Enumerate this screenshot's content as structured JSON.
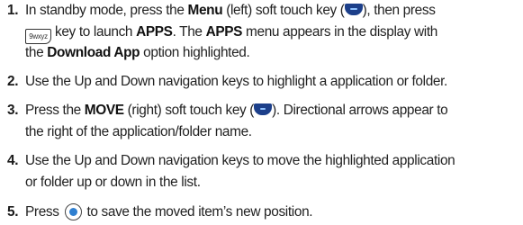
{
  "steps": [
    {
      "number": "1.",
      "lines": [
        {
          "a": "In standby mode, press the ",
          "b1": "Menu",
          "c": " (left) soft touch key (",
          "d": "), then press"
        },
        {
          "key9": "9wxyz",
          "a": "key to launch ",
          "b1": "APPS",
          "c": ". The ",
          "b2": "APPS",
          "d": " menu appears in the display with"
        },
        {
          "a": "the ",
          "b1": "Download App",
          "c": " option highlighted."
        }
      ]
    },
    {
      "number": "2.",
      "lines": [
        {
          "a": "Use the Up and Down navigation keys to highlight a application or folder."
        }
      ]
    },
    {
      "number": "3.",
      "lines": [
        {
          "a": "Press the ",
          "b1": "MOVE",
          "c": " (right) soft touch key (",
          "d": "). Directional arrows appear to"
        },
        {
          "a": "the right of the application/folder name."
        }
      ]
    },
    {
      "number": "4.",
      "lines": [
        {
          "a": "Use the Up and Down navigation keys to move the highlighted application"
        },
        {
          "a": "or folder up or down in the list."
        }
      ]
    },
    {
      "number": "5.",
      "lines": [
        {
          "a": "Press ",
          "c": " to save the moved item’s new position."
        }
      ]
    }
  ],
  "icons": {
    "left_soft_key": "left-soft-key-icon",
    "right_soft_key": "right-soft-key-icon",
    "nine_key": "nine-wxyz-key-icon",
    "ok_key": "ok-key-icon"
  }
}
